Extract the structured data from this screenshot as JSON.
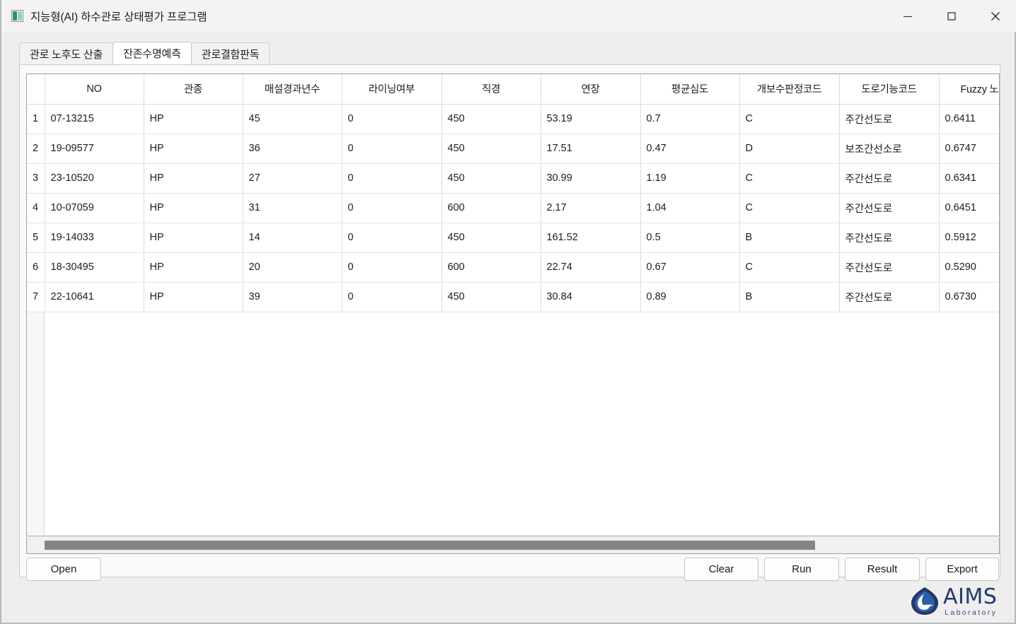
{
  "window": {
    "title": "지능형(AI) 하수관로 상태평가 프로그램",
    "icon": "application-image-icon",
    "controls": {
      "minimize": "minimize-icon",
      "maximize": "maximize-icon",
      "close": "close-icon"
    }
  },
  "tabs": [
    {
      "label": "관로 노후도 산출",
      "active": false
    },
    {
      "label": "잔존수명예측",
      "active": true
    },
    {
      "label": "관로결함판독",
      "active": false
    }
  ],
  "grid": {
    "columns": [
      "NO",
      "관종",
      "매설경과년수",
      "라이닝여부",
      "직경",
      "연장",
      "평균심도",
      "개보수판정코드",
      "도로기능코드",
      "Fuzzy 노후도"
    ],
    "rows": [
      {
        "n": "1",
        "cells": [
          "07-13215",
          "HP",
          "45",
          "0",
          "450",
          "53.19",
          "0.7",
          "C",
          "주간선도로",
          "0.6411"
        ]
      },
      {
        "n": "2",
        "cells": [
          "19-09577",
          "HP",
          "36",
          "0",
          "450",
          "17.51",
          "0.47",
          "D",
          "보조간선소로",
          "0.6747"
        ]
      },
      {
        "n": "3",
        "cells": [
          "23-10520",
          "HP",
          "27",
          "0",
          "450",
          "30.99",
          "1.19",
          "C",
          "주간선도로",
          "0.6341"
        ]
      },
      {
        "n": "4",
        "cells": [
          "10-07059",
          "HP",
          "31",
          "0",
          "600",
          "2.17",
          "1.04",
          "C",
          "주간선도로",
          "0.6451"
        ]
      },
      {
        "n": "5",
        "cells": [
          "19-14033",
          "HP",
          "14",
          "0",
          "450",
          "161.52",
          "0.5",
          "B",
          "주간선도로",
          "0.5912"
        ]
      },
      {
        "n": "6",
        "cells": [
          "18-30495",
          "HP",
          "20",
          "0",
          "600",
          "22.74",
          "0.67",
          "C",
          "주간선도로",
          "0.5290"
        ]
      },
      {
        "n": "7",
        "cells": [
          "22-10641",
          "HP",
          "39",
          "0",
          "450",
          "30.84",
          "0.89",
          "B",
          "주간선도로",
          "0.6730"
        ]
      }
    ]
  },
  "buttons": {
    "open": "Open",
    "clear": "Clear",
    "run": "Run",
    "result": "Result",
    "export": "Export"
  },
  "logo": {
    "name": "AIMS",
    "subtitle": "Laboratory",
    "mark": "water-drop-icon",
    "color": "#243a6b"
  }
}
